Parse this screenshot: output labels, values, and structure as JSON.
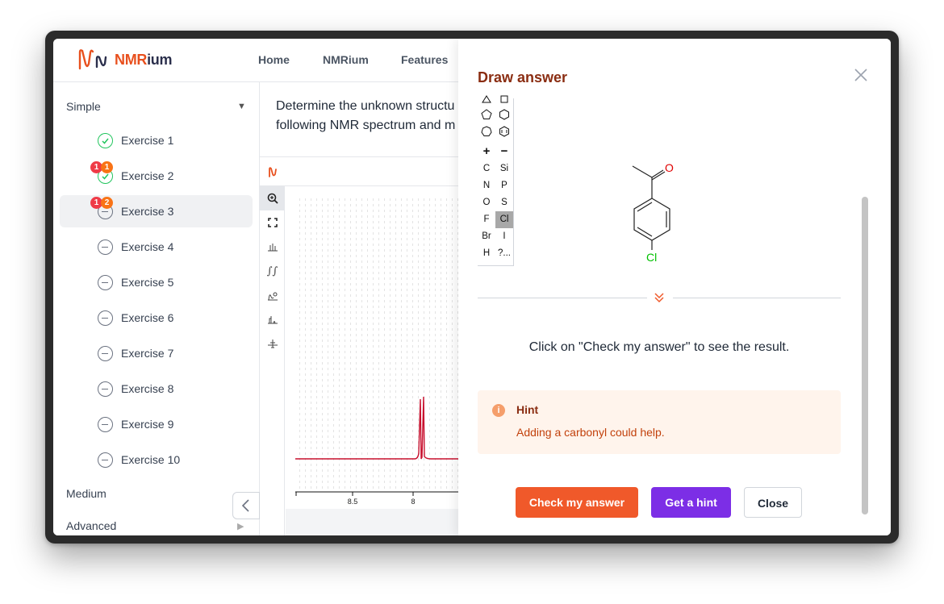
{
  "header": {
    "logo_prefix": "NMR",
    "logo_suffix": "ium",
    "nav": [
      "Home",
      "NMRium",
      "Features"
    ]
  },
  "sidebar": {
    "section_simple": "Simple",
    "section_medium": "Medium",
    "section_advanced": "Advanced",
    "exercises": [
      {
        "label": "Exercise 1",
        "status": "done"
      },
      {
        "label": "Exercise 2",
        "status": "done",
        "badges": [
          "1",
          "1"
        ]
      },
      {
        "label": "Exercise 3",
        "status": "pending",
        "badges": [
          "1",
          "2"
        ]
      },
      {
        "label": "Exercise 4",
        "status": "pending"
      },
      {
        "label": "Exercise 5",
        "status": "pending"
      },
      {
        "label": "Exercise 6",
        "status": "pending"
      },
      {
        "label": "Exercise 7",
        "status": "pending"
      },
      {
        "label": "Exercise 8",
        "status": "pending"
      },
      {
        "label": "Exercise 9",
        "status": "pending"
      },
      {
        "label": "Exercise 10",
        "status": "pending"
      }
    ]
  },
  "main": {
    "question_line1": "Determine the unknown structu",
    "question_line2": "following NMR spectrum and m",
    "axis_ticks": [
      "8.5",
      "8"
    ],
    "tools": [
      "zoom-icon",
      "full-view-icon",
      "peak-picking-icon",
      "integral-icon",
      "zero-filling-icon",
      "ranges-icon",
      "phase-icon"
    ]
  },
  "modal": {
    "title": "Draw answer",
    "atoms": [
      "C",
      "Si",
      "N",
      "P",
      "O",
      "S",
      "F",
      "Cl",
      "Br",
      "I",
      "H",
      "?..."
    ],
    "plus": "+",
    "minus": "−",
    "selected_atom": "Cl",
    "molecule": {
      "oxygen": "O",
      "chlorine": "Cl"
    },
    "result_message": "Click on \"Check my answer\" to see the result.",
    "hint_title": "Hint",
    "hint_icon": "i",
    "hint_text": "Adding a carbonyl could help.",
    "buttons": {
      "check": "Check my answer",
      "hint": "Get a hint",
      "close": "Close"
    }
  },
  "colors": {
    "brand_orange": "#f0592a",
    "hint_purple": "#7c2ee6",
    "spectrum_red": "#c8102e",
    "success_green": "#22c55e",
    "oxygen_red": "#e00000",
    "chlorine_green": "#00c000"
  }
}
